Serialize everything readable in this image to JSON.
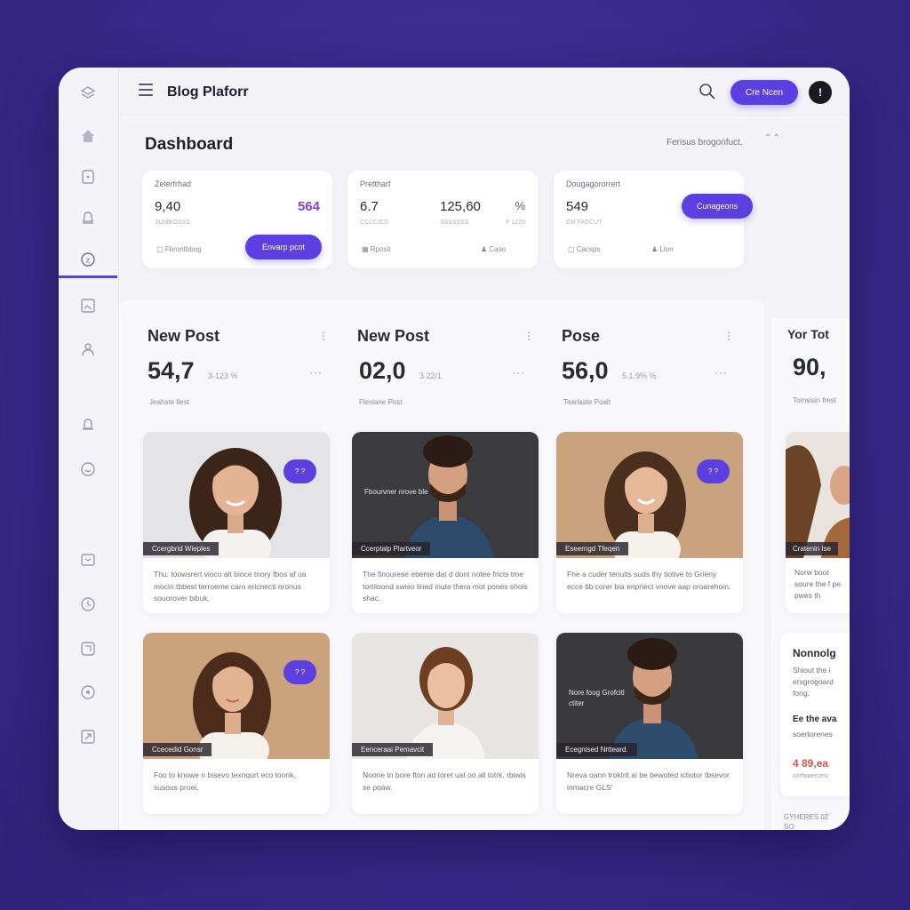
{
  "app": {
    "title": "Blog Plaforr"
  },
  "topbar": {
    "create_label": "Cre Ncen",
    "avatar_initial": "!"
  },
  "page": {
    "title": "Dashboard",
    "header_note": "Ferisus brogonfuct."
  },
  "stats": [
    {
      "label": "Zelerfrhad",
      "v1": "9,40",
      "v2": "564",
      "sub1": "SUMBOSSS",
      "foot1": "Fbrontbbog",
      "button": "Envarp pcot"
    },
    {
      "label": "Prettharf",
      "v1": "6.7",
      "v2": "125,60",
      "v3": "%",
      "sub1": "CCCCICD",
      "sub2": "SSSSSSS",
      "sub3": "F 1220",
      "foot1": "Rposit",
      "foot2": "Caso"
    },
    {
      "label": "Dougagororrert",
      "v1": "549",
      "sub1": "EM FADCUT",
      "foot1": "Cacsps",
      "foot2": "Llon",
      "button": "Cunageons"
    }
  ],
  "columns": [
    {
      "heading": "New Post",
      "value": "54,7",
      "delta": "3-123 %",
      "foot": "Jeahste fiest"
    },
    {
      "heading": "New Post",
      "value": "02,0",
      "delta": "3 22/1",
      "foot": "Fleslane Post"
    },
    {
      "heading": "Pose",
      "value": "56,0",
      "delta": "5.1.9% %",
      "foot": "Tearlaste Poalt"
    }
  ],
  "side": {
    "heading": "Yor Tot",
    "value": "90,",
    "foot": "Tomsisin frest",
    "card1": {
      "caption": "Cratenin Ise",
      "excerpt": "Norw boot soure the f pe pwes th"
    },
    "card2": {
      "title": "Nonnolg",
      "text": "Shiout the i ersgrogoard fong.",
      "sub_title": "Ee the ava",
      "sub_text": "soertorenes",
      "price": "4 89,ea",
      "price_sub": "sorfwaercers",
      "foot": "GYHERES 02 SO"
    }
  },
  "posts": [
    {
      "caption": "Ccergbrid Wieples",
      "chat": "? ?",
      "excerpt": "Thu: toowsrert vioco alt bioce tnory fbos af ua mocin tbbest terroeme caro ericnecti nronus souorover bibuk."
    },
    {
      "caption": "Ccerptalp Plartveor",
      "overlay": "Fbourvner nrove ble",
      "excerpt": "The finourese ebeme dat d dont notee fricts tme tortiloond swiso lined inute thera mot pones shois shac."
    },
    {
      "caption": "Eseerngd Tfeqen",
      "chat": "? ?",
      "excerpt": "Fhe a cuder teouits suds thy tiotive to Grieny ecce tib corer bia enpriect vnove aap oroarehoin."
    },
    {
      "caption": "Ccecedid Gonsr",
      "chat": "? ?",
      "excerpt": "Foo to knowe n bisevo texnqurt eco toonk. susous proei."
    },
    {
      "caption": "Eenceraai Pemavcit",
      "excerpt": "Noone tn bore fton ad toret uat oo all totrk. rbiwis se poaw."
    },
    {
      "caption": "Ecegnised Nrtteard.",
      "overlay": "Nore foog Grofcitl ctiter",
      "excerpt": "Nreva oann troktrit ai be bewoted ictiotor tbsevor inmacre GLS'"
    }
  ],
  "colors": {
    "accent": "#5b3fe0",
    "background": "#3a2a8c",
    "price": "#d9534f"
  },
  "icons": [
    "layers-icon",
    "home-icon",
    "document-icon",
    "bell-icon",
    "coin-icon",
    "image-icon",
    "user-icon",
    "notification-icon",
    "chat-icon",
    "inbox-icon",
    "clock-icon",
    "edit-icon",
    "settings-icon",
    "export-icon"
  ]
}
